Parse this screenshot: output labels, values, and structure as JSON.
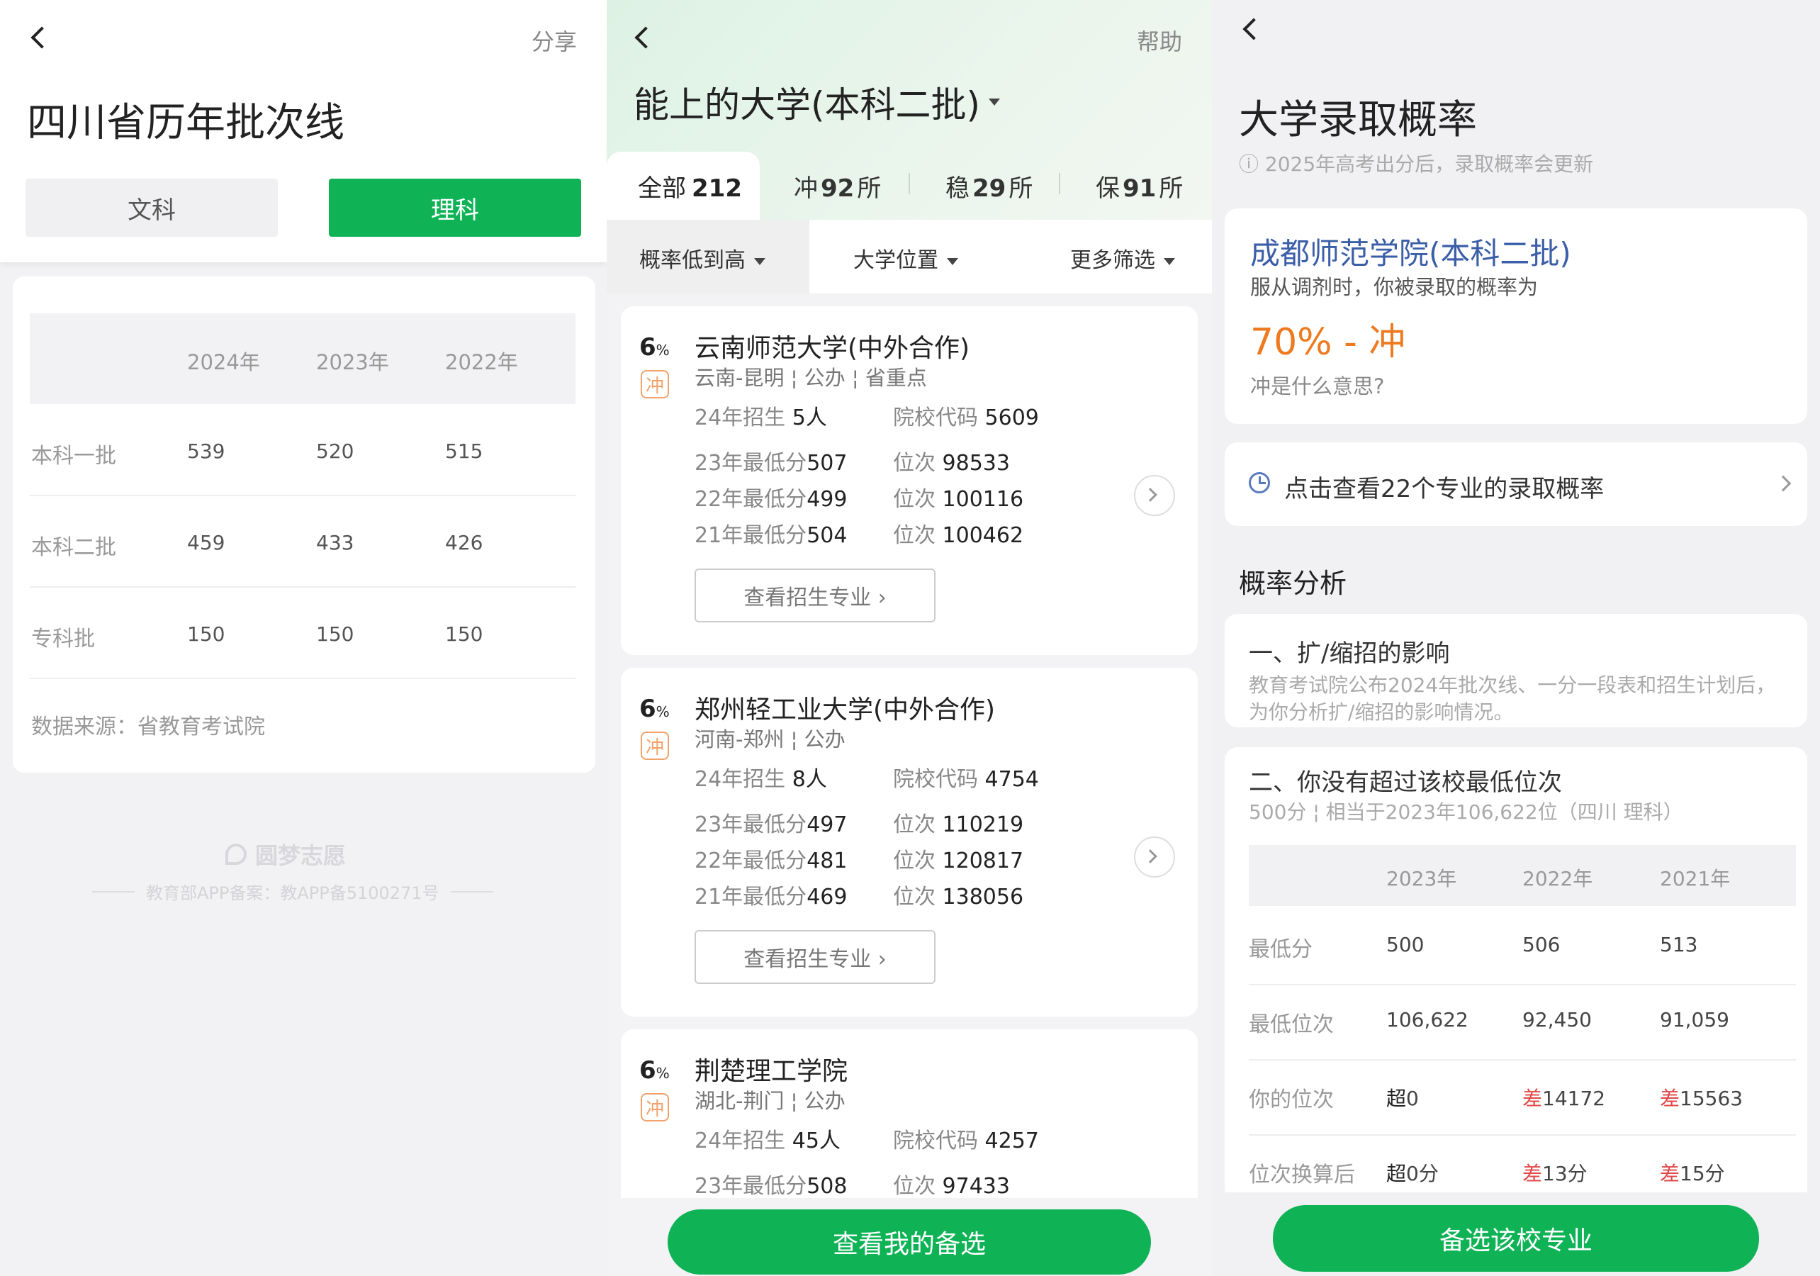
{
  "screen1": {
    "title": "四川省历年批次线",
    "share": "分享",
    "tabs": {
      "liberal": "文科",
      "science": "理科"
    },
    "table": {
      "headers": [
        "2024年",
        "2023年",
        "2022年"
      ],
      "rows": [
        {
          "label": "本科一批",
          "values": [
            "539",
            "520",
            "515"
          ]
        },
        {
          "label": "本科二批",
          "values": [
            "459",
            "433",
            "426"
          ]
        },
        {
          "label": "专科批",
          "values": [
            "150",
            "150",
            "150"
          ]
        }
      ]
    },
    "source": "数据来源：省教育考试院",
    "watermark": {
      "brand": "圆梦志愿",
      "record": "教育部APP备案：教APP备5100271号"
    }
  },
  "screen2": {
    "help": "帮助",
    "title": "能上的大学(本科二批)",
    "tabs": [
      {
        "prefix": "全部",
        "num": "212",
        "suffix": ""
      },
      {
        "prefix": "冲",
        "num": "92",
        "suffix": "所"
      },
      {
        "prefix": "稳",
        "num": "29",
        "suffix": "所"
      },
      {
        "prefix": "保",
        "num": "91",
        "suffix": "所"
      }
    ],
    "filters": [
      "概率低到高",
      "大学位置",
      "更多筛选"
    ],
    "universities": [
      {
        "pct": "6",
        "pct_unit": "%",
        "level": "冲",
        "name": "云南师范大学(中外合作)",
        "location": "云南-昆明 ¦ 公办 ¦ 省重点",
        "enroll_label": "24年招生",
        "enroll": "5人",
        "code_label": "院校代码",
        "code": "5609",
        "history": [
          {
            "label": "23年最低分",
            "score": "507",
            "rank_label": "位次",
            "rank": "98533"
          },
          {
            "label": "22年最低分",
            "score": "499",
            "rank_label": "位次",
            "rank": "100116"
          },
          {
            "label": "21年最低分",
            "score": "504",
            "rank_label": "位次",
            "rank": "100462"
          }
        ],
        "button": "查看招生专业 ›"
      },
      {
        "pct": "6",
        "pct_unit": "%",
        "level": "冲",
        "name": "郑州轻工业大学(中外合作)",
        "location": "河南-郑州 ¦ 公办",
        "enroll_label": "24年招生",
        "enroll": "8人",
        "code_label": "院校代码",
        "code": "4754",
        "history": [
          {
            "label": "23年最低分",
            "score": "497",
            "rank_label": "位次",
            "rank": "110219"
          },
          {
            "label": "22年最低分",
            "score": "481",
            "rank_label": "位次",
            "rank": "120817"
          },
          {
            "label": "21年最低分",
            "score": "469",
            "rank_label": "位次",
            "rank": "138056"
          }
        ],
        "button": "查看招生专业 ›"
      },
      {
        "pct": "6",
        "pct_unit": "%",
        "level": "冲",
        "name": "荆楚理工学院",
        "location": "湖北-荆门 ¦ 公办",
        "enroll_label": "24年招生",
        "enroll": "45人",
        "code_label": "院校代码",
        "code": "4257",
        "history": [
          {
            "label": "23年最低分",
            "score": "508",
            "rank_label": "位次",
            "rank": "97433"
          }
        ]
      }
    ],
    "bottom_button": "查看我的备选"
  },
  "screen3": {
    "title": "大学录取概率",
    "notice": "ⓘ 2025年高考出分后，录取概率会更新",
    "school": "成都师范学院(本科二批)",
    "prob_desc": "服从调剂时，你被录取的概率为",
    "prob": "70% - 冲",
    "what": "冲是什么意思?",
    "majors_link": "点击查看22个专业的录取概率",
    "analysis_title": "概率分析",
    "section1": {
      "title": "一、扩/缩招的影响",
      "desc": "教育考试院公布2024年批次线、一分一段表和招生计划后，为你分析扩/缩招的影响情况。"
    },
    "section2": {
      "title": "二、你没有超过该校最低位次",
      "desc": "500分 ¦ 相当于2023年106,622位（四川 理科）",
      "headers": [
        "2023年",
        "2022年",
        "2021年"
      ],
      "rows": [
        {
          "label": "最低分",
          "values": [
            [
              "",
              "500"
            ],
            [
              "",
              "506"
            ],
            [
              "",
              "513"
            ]
          ]
        },
        {
          "label": "最低位次",
          "values": [
            [
              "",
              "106,622"
            ],
            [
              "",
              "92,450"
            ],
            [
              "",
              "91,059"
            ]
          ]
        },
        {
          "label": "你的位次",
          "values": [
            [
              "超",
              "0"
            ],
            [
              "差",
              "14172"
            ],
            [
              "差",
              "15563"
            ]
          ]
        },
        {
          "label": "位次换算后",
          "values": [
            [
              "超",
              "0分"
            ],
            [
              "差",
              "13分"
            ],
            [
              "差",
              "15分"
            ]
          ]
        }
      ]
    },
    "bottom_button": "备选该校专业",
    "colors": {
      "green": "#0fb356",
      "orange": "#ee7a1f",
      "blue": "#3b5ea8",
      "red": "#e04848"
    }
  }
}
